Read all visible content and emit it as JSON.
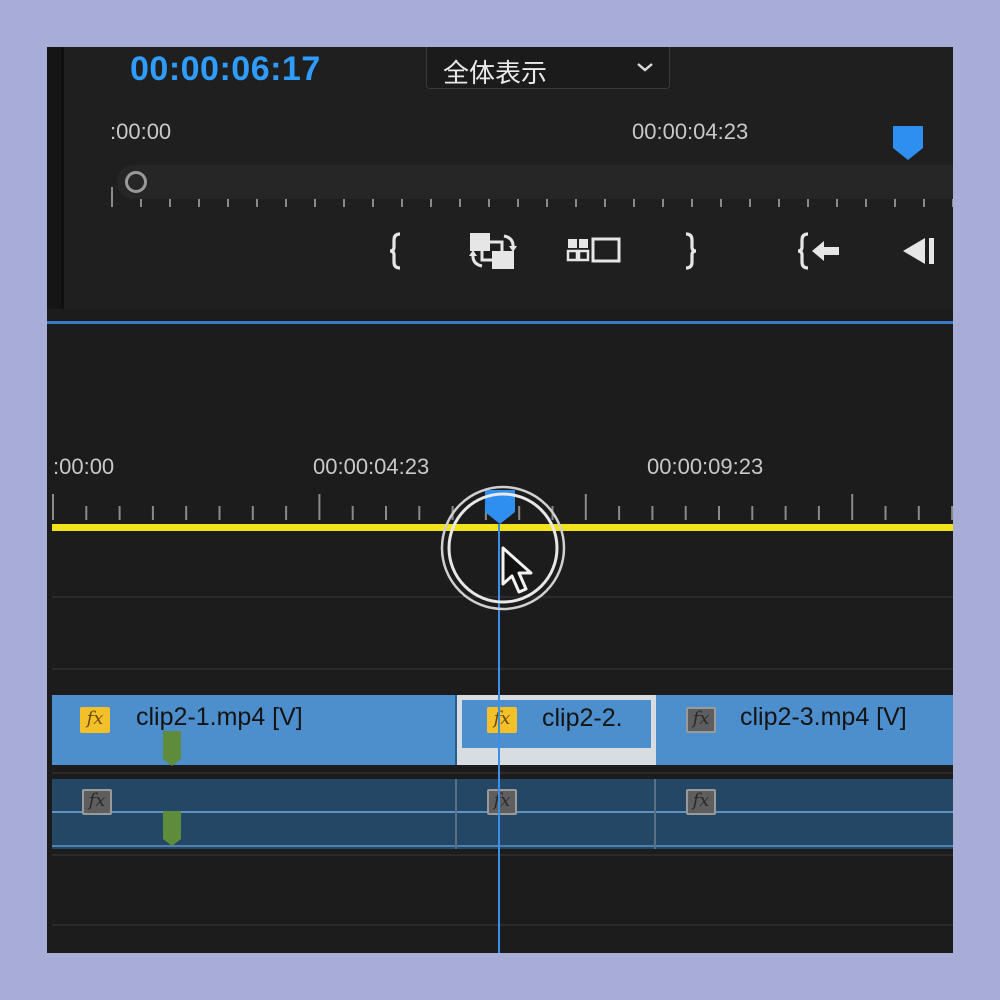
{
  "monitor": {
    "timecode": "00:00:06:17",
    "fit_dropdown": {
      "selected": "全体表示"
    },
    "ruler": {
      "start_label": ":00:00",
      "mid_label": "00:00:04:23"
    },
    "controls": [
      {
        "name": "mark-in-icon"
      },
      {
        "name": "lift-overwrite-icon"
      },
      {
        "name": "multicam-icon"
      },
      {
        "name": "mark-out-icon"
      },
      {
        "name": "go-to-in-icon"
      },
      {
        "name": "step-back-icon"
      }
    ]
  },
  "timeline": {
    "ruler": {
      "start_label": ":00:00",
      "mid_label": "00:00:04:23",
      "end_label": "00:00:09:23"
    },
    "video_clips": [
      {
        "name": "clip2-1.mp4 [V]",
        "fx": "on"
      },
      {
        "name": "clip2-2.",
        "fx": "on",
        "selected": true
      },
      {
        "name": "clip2-3.mp4 [V]",
        "fx": "off"
      }
    ],
    "audio_clips": [
      {
        "fx": "off"
      },
      {
        "fx": "off"
      },
      {
        "fx": "off"
      }
    ]
  },
  "colors": {
    "accent": "#2f9cff",
    "work_area": "#f2e21a",
    "video_clip": "#4d8fcc",
    "audio_clip": "#244766",
    "fx_on": "#f4c02a"
  }
}
